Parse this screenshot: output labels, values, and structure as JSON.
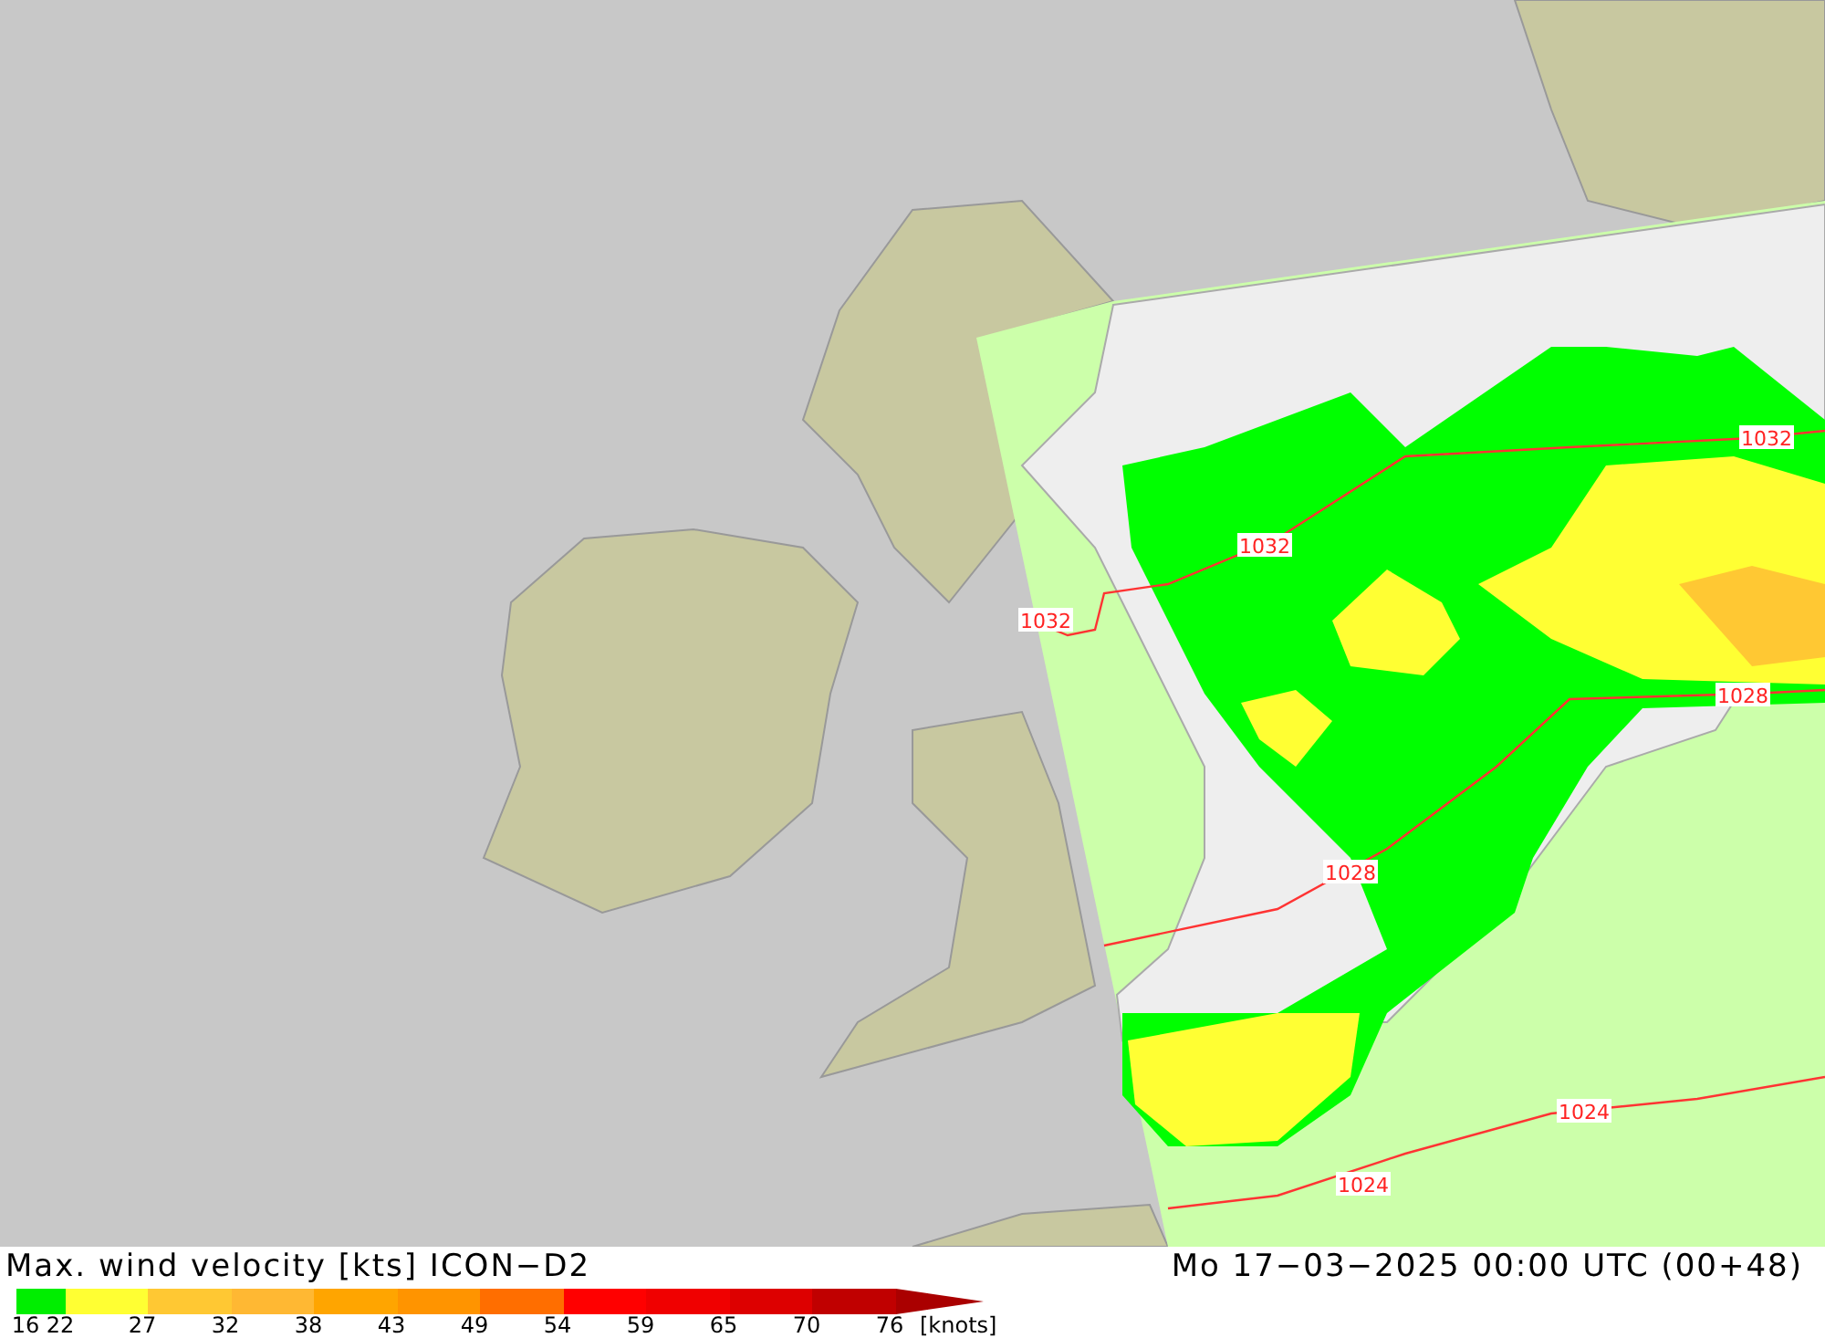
{
  "map": {
    "isobar_labels": [
      {
        "text": "1032"
      },
      {
        "text": "1032"
      },
      {
        "text": "1032"
      },
      {
        "text": "1028"
      },
      {
        "text": "1028"
      },
      {
        "text": "1024"
      },
      {
        "text": "1024"
      }
    ]
  },
  "legend": {
    "title": "Max. wind velocity [kts] ICON−D2",
    "valid_time": "Mo 17−03−2025 00:00 UTC (00+48)",
    "unit": "[knots]",
    "bins": [
      {
        "label": "16",
        "color": "#00ee00"
      },
      {
        "label": "22",
        "color": "#ffff33"
      },
      {
        "label": "27",
        "color": "#ffc833"
      },
      {
        "label": "32",
        "color": "#ffb833"
      },
      {
        "label": "38",
        "color": "#ffa500"
      },
      {
        "label": "43",
        "color": "#ff9400"
      },
      {
        "label": "49",
        "color": "#ff6e00"
      },
      {
        "label": "54",
        "color": "#ff0000"
      },
      {
        "label": "59",
        "color": "#f00000"
      },
      {
        "label": "65",
        "color": "#dd0000"
      },
      {
        "label": "70",
        "color": "#c00000"
      },
      {
        "label": "76",
        "color": "#aa0000"
      }
    ]
  }
}
